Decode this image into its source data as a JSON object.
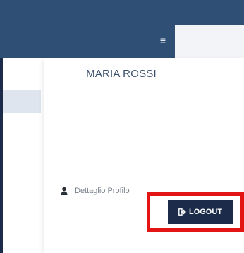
{
  "header": {
    "menu_icon": "hamburger-icon",
    "colors": {
      "navy": "#2f4f74",
      "button": "#1c2b4a",
      "highlight": "#e31414"
    }
  },
  "user_menu": {
    "user_name": "MARIA ROSSI",
    "profile_link": {
      "icon": "user-icon",
      "label": "Dettaglio Profilo"
    },
    "logout_button": {
      "icon": "sign-out-icon",
      "label": "LOGOUT"
    }
  }
}
